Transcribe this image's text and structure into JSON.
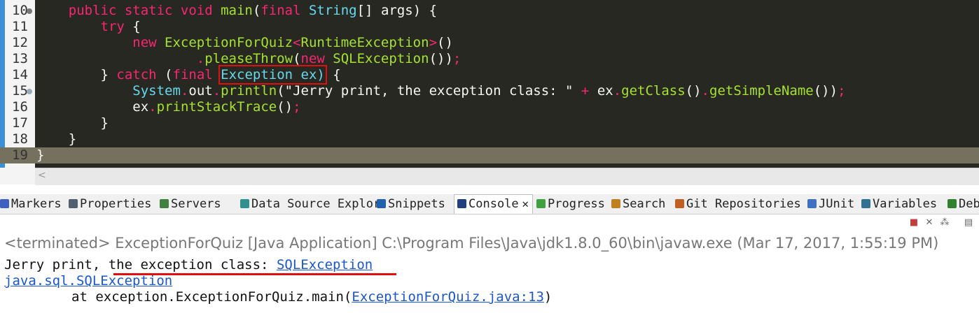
{
  "editor": {
    "lines": [
      {
        "num": "10",
        "tokens": [
          [
            "",
            "    "
          ],
          [
            "k",
            "public static void "
          ],
          [
            "f",
            "main"
          ],
          [
            "p",
            "("
          ],
          [
            "k",
            "final "
          ],
          [
            "t",
            "String"
          ],
          [
            "p",
            "[] "
          ],
          [
            "p",
            "args"
          ],
          [
            "p",
            ") {"
          ]
        ]
      },
      {
        "num": "11",
        "tokens": [
          [
            "",
            "        "
          ],
          [
            "k",
            "try"
          ],
          [
            "p",
            " {"
          ]
        ]
      },
      {
        "num": "12",
        "tokens": [
          [
            "",
            "            "
          ],
          [
            "k",
            "new "
          ],
          [
            "g",
            "ExceptionForQuiz"
          ],
          [
            "k",
            "<"
          ],
          [
            "g",
            "RuntimeException"
          ],
          [
            "k",
            ">"
          ],
          [
            "p",
            "()"
          ]
        ]
      },
      {
        "num": "13",
        "tokens": [
          [
            "",
            "                    "
          ],
          [
            "k",
            "."
          ],
          [
            "g",
            "pleaseThrow"
          ],
          [
            "p",
            "("
          ],
          [
            "k",
            "new "
          ],
          [
            "g",
            "SQLException"
          ],
          [
            "p",
            "())"
          ],
          [
            "k",
            ";"
          ]
        ]
      },
      {
        "num": "14",
        "tokens": [
          [
            "",
            "        "
          ],
          [
            "p",
            "} "
          ],
          [
            "k",
            "catch "
          ],
          [
            "p",
            "("
          ],
          [
            "k",
            "final "
          ],
          [
            "box",
            "Exception ex)"
          ],
          [
            "p",
            " {"
          ]
        ]
      },
      {
        "num": "15",
        "tokens": [
          [
            "",
            "            "
          ],
          [
            "t",
            "System"
          ],
          [
            "k",
            "."
          ],
          [
            "p",
            "out"
          ],
          [
            "k",
            "."
          ],
          [
            "g",
            "println"
          ],
          [
            "p",
            "(\"Jerry print, the exception class: \" "
          ],
          [
            "k",
            "+ "
          ],
          [
            "p",
            "ex"
          ],
          [
            "k",
            "."
          ],
          [
            "g",
            "getClass"
          ],
          [
            "p",
            "()"
          ],
          [
            "k",
            "."
          ],
          [
            "g",
            "getSimpleName"
          ],
          [
            "p",
            "())"
          ],
          [
            "k",
            ";"
          ]
        ]
      },
      {
        "num": "16",
        "tokens": [
          [
            "",
            "            "
          ],
          [
            "p",
            "ex"
          ],
          [
            "k",
            "."
          ],
          [
            "g",
            "printStackTrace"
          ],
          [
            "p",
            "()"
          ],
          [
            "k",
            ";"
          ]
        ]
      },
      {
        "num": "17",
        "tokens": [
          [
            "",
            "        "
          ],
          [
            "p",
            "}"
          ]
        ]
      },
      {
        "num": "18",
        "tokens": [
          [
            "",
            "    "
          ],
          [
            "p",
            "}"
          ]
        ]
      },
      {
        "num": "19",
        "tokens": [
          [
            "p",
            "}"
          ]
        ]
      }
    ]
  },
  "tabs": [
    {
      "label": "Markers",
      "icon": "markers-icon"
    },
    {
      "label": "Properties",
      "icon": "properties-icon"
    },
    {
      "label": "Servers",
      "icon": "servers-icon"
    },
    {
      "label": "Data Source Explor",
      "icon": "datasource-icon"
    },
    {
      "label": "Snippets",
      "icon": "snippets-icon"
    },
    {
      "label": "Console",
      "icon": "console-icon",
      "active": true,
      "close": "✕"
    },
    {
      "label": "Progress",
      "icon": "progress-icon"
    },
    {
      "label": "Search",
      "icon": "search-icon"
    },
    {
      "label": "Git Repositories",
      "icon": "git-icon"
    },
    {
      "label": "JUnit",
      "icon": "junit-icon"
    },
    {
      "label": "Variables",
      "icon": "variables-icon"
    },
    {
      "label": "Deb",
      "icon": "debug-icon"
    }
  ],
  "console": {
    "terminated": "<terminated> ExceptionForQuiz [Java Application] C:\\Program Files\\Java\\jdk1.8.0_60\\bin\\javaw.exe (Mar 17, 2017, 1:55:19 PM)",
    "line1_prefix": "Jerry print, the exception class: ",
    "line1_link": "SQLException",
    "line2_link": "java.sql.SQLException",
    "line3_prefix": "\tat exception.ExceptionForQuiz.main(",
    "line3_link": "ExceptionForQuiz.java:13",
    "line3_suffix": ")"
  },
  "colors": {
    "editor_bg": "#272822",
    "current_line": "#75715e",
    "keyword": "#f92672",
    "type": "#66d9ef",
    "method": "#a6e22e",
    "highlight_box": "#e01010",
    "link": "#1a56cc"
  }
}
